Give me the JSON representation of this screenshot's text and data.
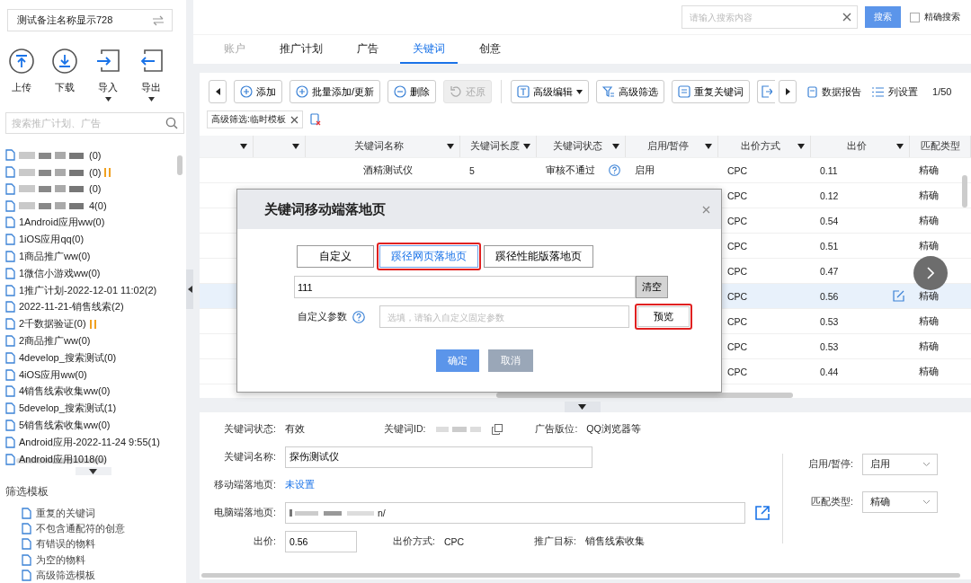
{
  "account_switcher": {
    "label": "测试备注名称显示728"
  },
  "sidebar_actions": [
    {
      "label": "上传",
      "kind": "upload",
      "has_menu": false
    },
    {
      "label": "下载",
      "kind": "download",
      "has_menu": false
    },
    {
      "label": "导入",
      "kind": "import",
      "has_menu": true
    },
    {
      "label": "导出",
      "kind": "export",
      "has_menu": true
    }
  ],
  "sidebar_search": {
    "placeholder": "搜索推广计划、广告"
  },
  "plans": [
    {
      "label": "(0)",
      "redacted": true,
      "paused": false
    },
    {
      "label": "(0)",
      "redacted": true,
      "paused": true
    },
    {
      "label": " (0)",
      "redacted": true,
      "paused": false
    },
    {
      "label": "4(0)",
      "redacted": true,
      "paused": false
    },
    {
      "label": "1Android应用ww(0)",
      "redacted": false,
      "paused": false
    },
    {
      "label": "1iOS应用qq(0)",
      "redacted": false,
      "paused": false
    },
    {
      "label": "1商品推广ww(0)",
      "redacted": false,
      "paused": false
    },
    {
      "label": "1微信小游戏ww(0)",
      "redacted": false,
      "paused": false
    },
    {
      "label": "1推广计划-2022-12-01 11:02(2)",
      "redacted": false,
      "paused": false
    },
    {
      "label": "2022-11-21-销售线索(2)",
      "redacted": false,
      "paused": false
    },
    {
      "label": "2千数据验证(0)",
      "redacted": false,
      "paused": true
    },
    {
      "label": "2商品推广ww(0)",
      "redacted": false,
      "paused": false
    },
    {
      "label": "4develop_搜索测试(0)",
      "redacted": false,
      "paused": false
    },
    {
      "label": "4iOS应用ww(0)",
      "redacted": false,
      "paused": false
    },
    {
      "label": "4销售线索收集ww(0)",
      "redacted": false,
      "paused": false
    },
    {
      "label": "5develop_搜索测试(1)",
      "redacted": false,
      "paused": false
    },
    {
      "label": "5销售线索收集ww(0)",
      "redacted": false,
      "paused": false
    },
    {
      "label": "Android应用-2022-11-24 9:55(1)",
      "redacted": false,
      "paused": false
    },
    {
      "label": "Android应用1018(0)",
      "redacted": false,
      "paused": false
    }
  ],
  "filter_templates": {
    "title": "筛选模板",
    "items": [
      "重复的关键词",
      "不包含通配符的创意",
      "有错误的物料",
      "为空的物料",
      "高级筛选模板"
    ]
  },
  "header_search": {
    "placeholder": "请输入搜索内容",
    "button": "搜索",
    "exact_label": "精确搜索",
    "exact_checked": false
  },
  "tabs": [
    {
      "label": "账户",
      "selected": false,
      "disabled": true
    },
    {
      "label": "推广计划",
      "selected": false,
      "disabled": false
    },
    {
      "label": "广告",
      "selected": false,
      "disabled": false
    },
    {
      "label": "关键词",
      "selected": true,
      "disabled": false
    },
    {
      "label": "创意",
      "selected": false,
      "disabled": false
    }
  ],
  "toolbar": {
    "buttons": [
      {
        "label": "添加",
        "disabled": false,
        "caret": false
      },
      {
        "label": "批量添加/更新",
        "disabled": false,
        "caret": false
      },
      {
        "label": "删除",
        "disabled": false,
        "caret": false
      },
      {
        "label": "还原",
        "disabled": true,
        "caret": false
      },
      {
        "label": "高级编辑",
        "disabled": false,
        "caret": true
      },
      {
        "label": "高级筛选",
        "disabled": false,
        "caret": false
      },
      {
        "label": "重复关键词",
        "disabled": false,
        "caret": false
      }
    ],
    "links": [
      "数据报告",
      "列设置"
    ],
    "page": "1/50"
  },
  "filter_tag": {
    "label": "高级筛选:临时模板"
  },
  "table": {
    "columns": [
      "关键词名称",
      "关键词长度",
      "关键词状态",
      "启用/暂停",
      "出价方式",
      "出价",
      "匹配类型"
    ],
    "rows": [
      {
        "name": "酒精测试仪",
        "length": "5",
        "status": "审核不通过",
        "enabled": "启用",
        "bid_type": "CPC",
        "bid": "0.11",
        "match": "精确",
        "selected": false
      },
      {
        "bid_type": "CPC",
        "bid": "0.12",
        "match": "精确",
        "selected": false
      },
      {
        "bid_type": "CPC",
        "bid": "0.54",
        "match": "精确",
        "selected": false
      },
      {
        "bid_type": "CPC",
        "bid": "0.51",
        "match": "精确",
        "selected": false
      },
      {
        "bid_type": "CPC",
        "bid": "0.47",
        "selected": false
      },
      {
        "bid_type": "CPC",
        "bid": "0.56",
        "match": "精确",
        "selected": true
      },
      {
        "bid_type": "CPC",
        "bid": "0.53",
        "match": "精确",
        "selected": false
      },
      {
        "bid_type": "CPC",
        "bid": "0.53",
        "match": "精确",
        "selected": false
      },
      {
        "bid_type": "CPC",
        "bid": "0.44",
        "match": "精确",
        "selected": false
      }
    ]
  },
  "modal": {
    "title": "关键词移动端落地页",
    "options": [
      {
        "label": "自定义",
        "selected": false,
        "highlighted": false
      },
      {
        "label": "蹊径网页落地页",
        "selected": true,
        "highlighted": true
      },
      {
        "label": "蹊径性能版落地页",
        "selected": false,
        "highlighted": false
      }
    ],
    "url": {
      "value": "111",
      "clear": "清空"
    },
    "param": {
      "label": "自定义参数",
      "placeholder": "选填，请输入自定义固定参数",
      "preview": "预览",
      "preview_highlighted": true
    },
    "ok": "确定",
    "cancel": "取消"
  },
  "detail": {
    "status": {
      "label": "关键词状态:",
      "value": "有效"
    },
    "keyword_id": {
      "label": "关键词ID:"
    },
    "ad_slot": {
      "label": "广告版位:",
      "value": "QQ浏览器等"
    },
    "name": {
      "label": "关键词名称:",
      "value": "探伤测试仪"
    },
    "mobile": {
      "label": "移动端落地页:",
      "link": "未设置"
    },
    "pc": {
      "label": "电脑端落地页:",
      "value": "n/"
    },
    "bid": {
      "label": "出价:",
      "value": "0.56"
    },
    "bid_type": {
      "label": "出价方式:",
      "value": "CPC"
    },
    "goal": {
      "label": "推广目标:",
      "value": "销售线索收集"
    },
    "selects": [
      {
        "label": "启用/暂停:",
        "value": "启用"
      },
      {
        "label": "匹配类型:",
        "value": "精确"
      }
    ]
  }
}
